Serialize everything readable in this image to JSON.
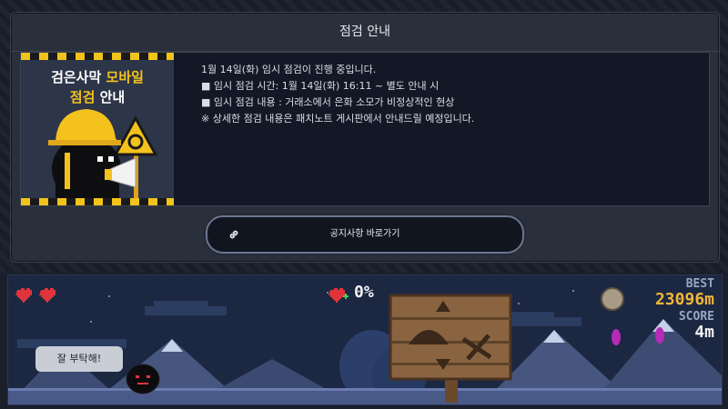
{
  "dialog": {
    "title": "점검 안내",
    "banner": {
      "line1_a": "검은사막 ",
      "line1_b": "모바일",
      "line2_a": "점검",
      "line2_b": " 안내"
    },
    "notice_lines": [
      "1월 14일(화) 임시 점검이 진행 중입니다.",
      "",
      "■ 임시 점검 시간: 1월 14일(화) 16:11 ~ 별도 안내 시",
      "■ 임시 점검 내용 : 거래소에서 은화 소모가 비정상적인 현상",
      "",
      "※ 상세한 점검 내용은 패치노트 게시판에서 안내드릴 예정입니다."
    ],
    "link_button_label": "공지사항 바로가기"
  },
  "game": {
    "percent": "0%",
    "best_label": "BEST",
    "best_value": "23096m",
    "score_label": "SCORE",
    "score_value": "4m",
    "speech": "잘 부탁해!",
    "lives": 2,
    "colors": {
      "gold": "#f2b63a",
      "sky": "#1c2742",
      "heart": "#e0343a"
    }
  }
}
